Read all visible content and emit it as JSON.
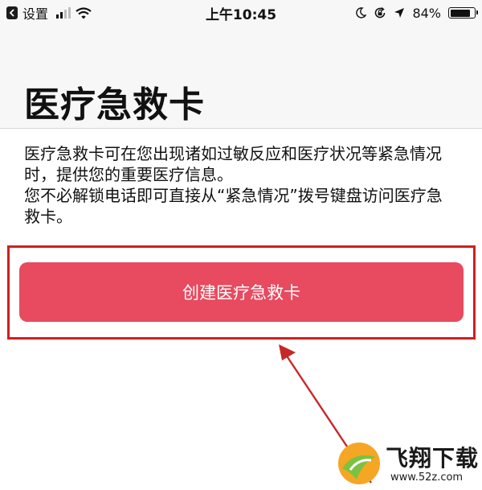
{
  "status_bar": {
    "back_label": "设置",
    "time": "上午10:45",
    "battery": "84%",
    "battery_level": 0.84,
    "icons": [
      "signal-icon",
      "wifi-icon",
      "moon-icon",
      "rotation-lock-icon",
      "location-icon",
      "battery-icon"
    ]
  },
  "page": {
    "title": "医疗急救卡"
  },
  "description": {
    "line1": "医疗急救卡可在您出现诸如过敏反应和医疗状况等紧急情况时，提供您的重要医疗信息。",
    "line2": "您不必解锁电话即可直接从“紧急情况”拨号键盘访问医疗急救卡。"
  },
  "actions": {
    "create_label": "创建医疗急救卡"
  },
  "watermark": {
    "brand": "飞翔下载",
    "url": "www.52z.com"
  },
  "colors": {
    "button": "#e84a5f",
    "highlight": "#cf1f1f",
    "arrow": "#c62828"
  }
}
